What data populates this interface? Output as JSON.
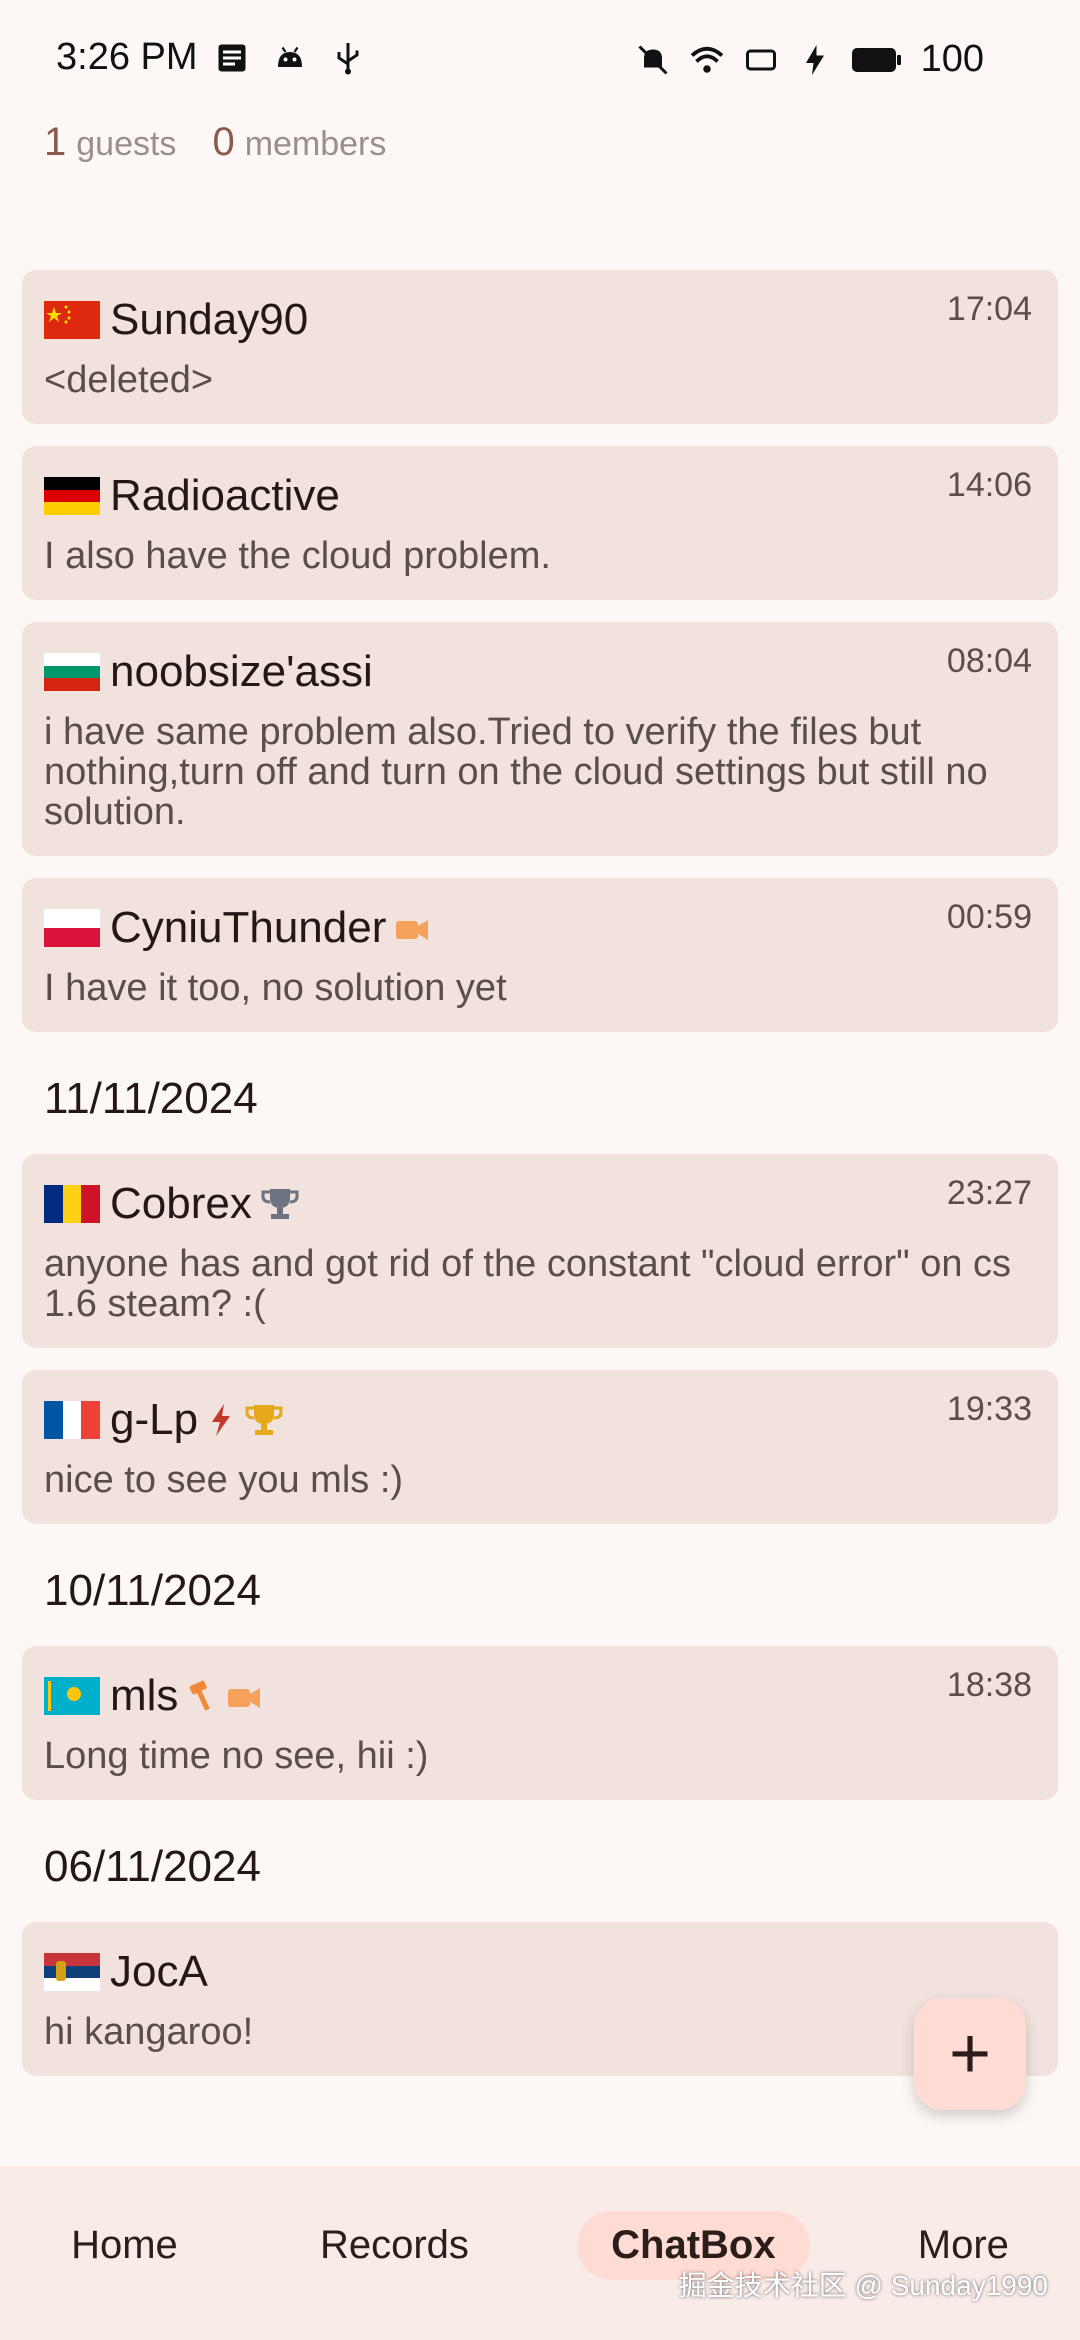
{
  "status_bar": {
    "time": "3:26 PM",
    "battery": "100",
    "left_icons": [
      "notes-icon",
      "android-icon",
      "usb-icon"
    ],
    "right_icons": [
      "mute-icon",
      "wifi-icon",
      "cast-icon",
      "charging-icon",
      "battery-icon"
    ]
  },
  "online": {
    "guests_count": "1",
    "guests_label": "guests",
    "members_count": "0",
    "members_label": "members"
  },
  "messages_group_1": [
    {
      "name": "Sunday90",
      "flag": "china",
      "badges": [],
      "time": "17:04",
      "text": "<deleted>"
    },
    {
      "name": "Radioactive",
      "flag": "germany",
      "badges": [],
      "time": "14:06",
      "text": "I also have the cloud problem."
    },
    {
      "name": "noobsize'assi",
      "flag": "bulgaria",
      "badges": [],
      "time": "08:04",
      "text": "i have same problem also.Tried to verify the files but nothing,turn off and turn on the cloud settings but still no solution."
    },
    {
      "name": "CyniuThunder",
      "flag": "poland",
      "badges": [
        "video-camera-icon"
      ],
      "time": "00:59",
      "text": "I have it too, no solution yet"
    }
  ],
  "date_2": "11/11/2024",
  "messages_group_2": [
    {
      "name": "Cobrex",
      "flag": "romania",
      "badges": [
        "trophy-gray-icon"
      ],
      "time": "23:27",
      "text": "anyone has and got rid of the constant \"cloud error\" on cs 1.6 steam? :("
    },
    {
      "name": "g-Lp",
      "flag": "france",
      "badges": [
        "lightning-icon",
        "trophy-gold-icon"
      ],
      "time": "19:33",
      "text": "nice to see you mls :)"
    }
  ],
  "date_3": "10/11/2024",
  "messages_group_3": [
    {
      "name": "mls",
      "flag": "kazakhstan",
      "badges": [
        "hammer-icon",
        "video-camera-icon"
      ],
      "time": "18:38",
      "text": "Long time no see, hii :)"
    }
  ],
  "date_4": "06/11/2024",
  "messages_group_4": [
    {
      "name": "JocA",
      "flag": "serbia",
      "badges": [],
      "time": "",
      "text": "hi kangaroo!"
    }
  ],
  "fab": {
    "icon": "plus-icon",
    "label": "+"
  },
  "bottom_nav": {
    "items": [
      "Home",
      "Records",
      "ChatBox",
      "More"
    ],
    "active": "ChatBox"
  },
  "watermark": "掘金技术社区 @ Sunday1990",
  "colors": {
    "background": "#fdf8f6",
    "card": "#f1e2de",
    "accent": "#ffdcd3",
    "count": "#8a5a4a"
  }
}
